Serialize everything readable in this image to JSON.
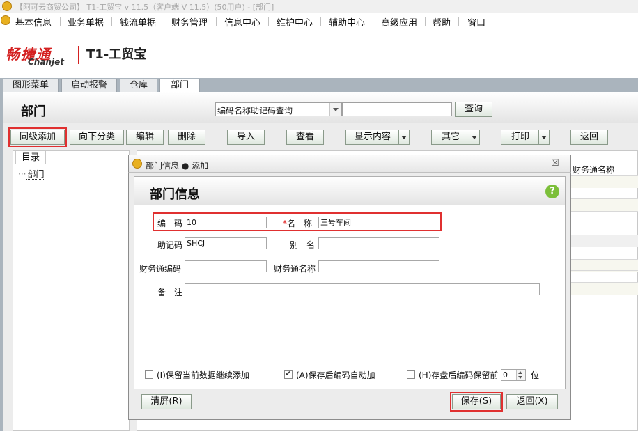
{
  "window": {
    "title": "【阿可云商贸公司】 T1-工贸宝 v 11.5（客户端 V 11.5）(50用户) - [部门]"
  },
  "menu": [
    "基本信息",
    "业务单据",
    "钱流单据",
    "财务管理",
    "信息中心",
    "维护中心",
    "辅助中心",
    "高级应用",
    "帮助",
    "窗口"
  ],
  "brand": {
    "cn": "畅捷通",
    "en": "Chanjet",
    "product": "T1-工贸宝",
    "accent": "#d42121"
  },
  "tabs": [
    {
      "label": "图形菜单",
      "active": false
    },
    {
      "label": "启动报警",
      "active": false
    },
    {
      "label": "仓库",
      "active": false
    },
    {
      "label": "部门",
      "active": true
    }
  ],
  "page": {
    "title": "部门",
    "search_combo": "编码名称助记码查询",
    "search_value": "",
    "query_button": "查询"
  },
  "toolbar": [
    "同级添加",
    "向下分类",
    "编辑",
    "删除",
    "导入",
    "查看",
    "显示内容",
    "其它",
    "打印",
    "返回"
  ],
  "directory": {
    "tab": "目录",
    "root": "部门"
  },
  "grid": {
    "visible_column": "财务通名称"
  },
  "dialog": {
    "title": "部门信息 ● 添加",
    "close": "☒",
    "form_title": "部门信息",
    "help": "?",
    "fields": {
      "code": {
        "label": "编　码",
        "value": "10"
      },
      "name": {
        "label": "名　称",
        "value": "三号车间",
        "required_mark": "*"
      },
      "mnemonic": {
        "label": "助记码",
        "value": "SHCJ"
      },
      "alias": {
        "label": "别　名",
        "value": ""
      },
      "fin_code": {
        "label": "财务通编码",
        "value": ""
      },
      "fin_name": {
        "label": "财务通名称",
        "value": ""
      },
      "remark": {
        "label": "备　注",
        "value": ""
      }
    },
    "options": {
      "keep_data": {
        "label": "(I)保留当前数据继续添加",
        "checked": false
      },
      "auto_inc": {
        "label": "(A)保存后编码自动加一",
        "checked": true
      },
      "keep_prefix": {
        "label": "(H)存盘后编码保留前",
        "checked": false,
        "digits": "0",
        "unit": "位"
      }
    },
    "buttons": {
      "clear": "清屏(R)",
      "save": "保存(S)",
      "back": "返回(X)"
    }
  }
}
